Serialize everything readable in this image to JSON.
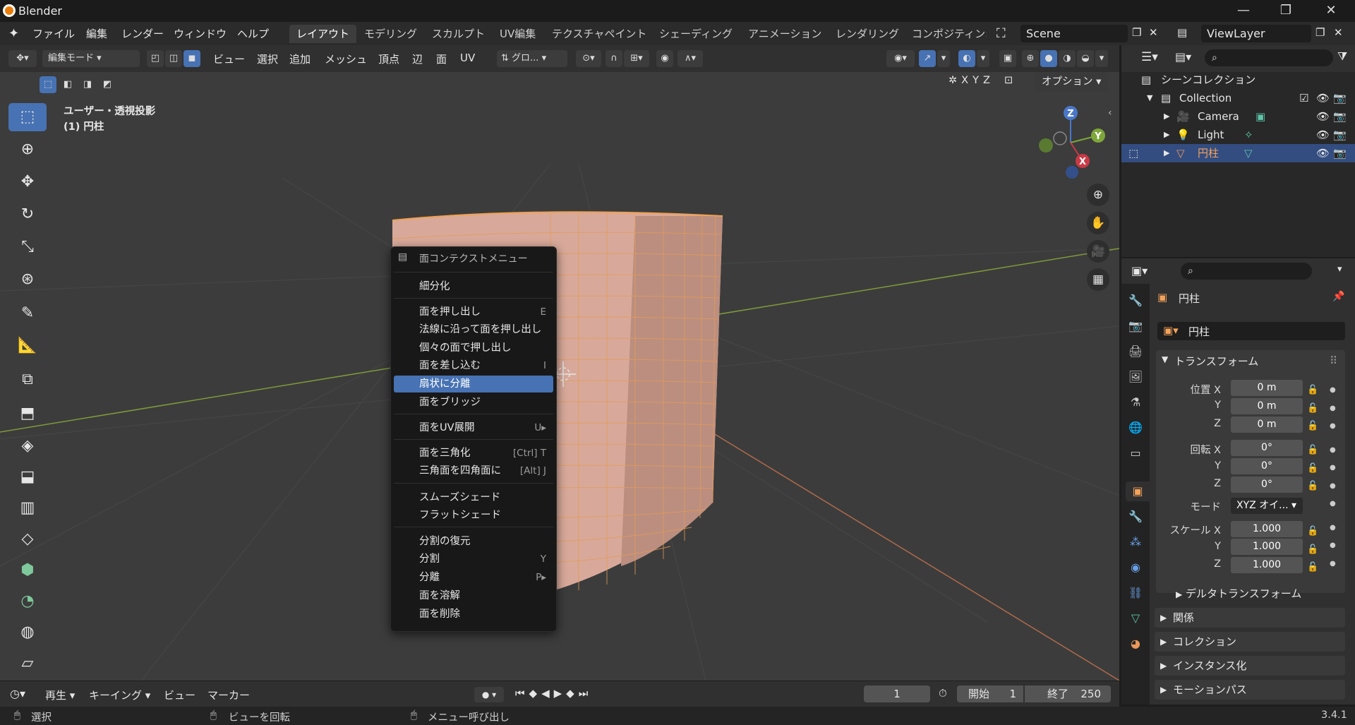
{
  "window": {
    "title": "Blender",
    "minimize": "—",
    "maximize": "❐",
    "close": "✕"
  },
  "menu": {
    "file": "ファイル",
    "edit": "編集",
    "render": "レンダー",
    "window": "ウィンドウ",
    "help": "ヘルプ"
  },
  "workspaces": [
    "レイアウト",
    "モデリング",
    "スカルプト",
    "UV編集",
    "テクスチャペイント",
    "シェーディング",
    "アニメーション",
    "レンダリング",
    "コンポジティン:"
  ],
  "scene": {
    "name": "Scene",
    "view_layer": "ViewLayer"
  },
  "viewport_header": {
    "mode": "編集モード",
    "view": "ビュー",
    "select": "選択",
    "add": "追加",
    "mesh": "メッシュ",
    "vertex": "頂点",
    "edge": "辺",
    "face": "面",
    "uv": "UV",
    "orientation": "グロ...",
    "options": "オプション",
    "x": "X",
    "y": "Y",
    "z": "Z"
  },
  "viewport": {
    "view_label": "ユーザー・透視投影",
    "object_label": "(1) 円柱",
    "gizmo": {
      "x": "X",
      "y": "Y",
      "z": "Z"
    }
  },
  "context_menu": {
    "title": "面コンテクストメニュー",
    "items": [
      {
        "label": "細分化",
        "shortcut": ""
      },
      {
        "label": "面を押し出し",
        "shortcut": "E"
      },
      {
        "label": "法線に沿って面を押し出し",
        "shortcut": ""
      },
      {
        "label": "個々の面で押し出し",
        "shortcut": ""
      },
      {
        "label": "面を差し込む",
        "shortcut": "I"
      },
      {
        "label": "扇状に分離",
        "shortcut": ""
      },
      {
        "label": "面をブリッジ",
        "shortcut": ""
      },
      {
        "label": "面をUV展開",
        "shortcut": "U▸"
      },
      {
        "label": "面を三角化",
        "shortcut": "[Ctrl] T"
      },
      {
        "label": "三角面を四角面に",
        "shortcut": "[Alt] J"
      },
      {
        "label": "スムーズシェード",
        "shortcut": ""
      },
      {
        "label": "フラットシェード",
        "shortcut": ""
      },
      {
        "label": "分割の復元",
        "shortcut": ""
      },
      {
        "label": "分割",
        "shortcut": "Y"
      },
      {
        "label": "分離",
        "shortcut": "P▸"
      },
      {
        "label": "面を溶解",
        "shortcut": ""
      },
      {
        "label": "面を削除",
        "shortcut": ""
      }
    ]
  },
  "outliner": {
    "scene_collection": "シーンコレクション",
    "collection": "Collection",
    "objects": [
      {
        "name": "Camera"
      },
      {
        "name": "Light"
      },
      {
        "name": "円柱"
      }
    ]
  },
  "properties": {
    "object_name": "円柱",
    "object_field": "円柱",
    "transform": "トランスフォーム",
    "location_label": "位置 X",
    "rotation_label": "回転 X",
    "scale_label": "スケール X",
    "y": "Y",
    "z": "Z",
    "location": [
      "0 m",
      "0 m",
      "0 m"
    ],
    "rotation": [
      "0°",
      "0°",
      "0°"
    ],
    "mode_label": "モード",
    "mode_value": "XYZ オイ...",
    "scale": [
      "1.000",
      "1.000",
      "1.000"
    ],
    "delta": "デルタトランスフォーム",
    "relations": "関係",
    "collections": "コレクション",
    "instancing": "インスタンス化",
    "motion_paths": "モーションパス"
  },
  "timeline": {
    "play": "再生",
    "keying": "キーイング",
    "view": "ビュー",
    "marker": "マーカー",
    "current_frame": "1",
    "start_label": "開始",
    "start": "1",
    "end_label": "終了",
    "end": "250"
  },
  "status": {
    "select": "選択",
    "rotate_view": "ビューを回転",
    "call_menu": "メニュー呼び出し",
    "version": "3.4.1"
  },
  "colors": {
    "accent": "#4772b3",
    "mesh_face": "#d8a99a",
    "mesh_edge": "#f0a050",
    "highlight_cursor": "#e0001a"
  }
}
